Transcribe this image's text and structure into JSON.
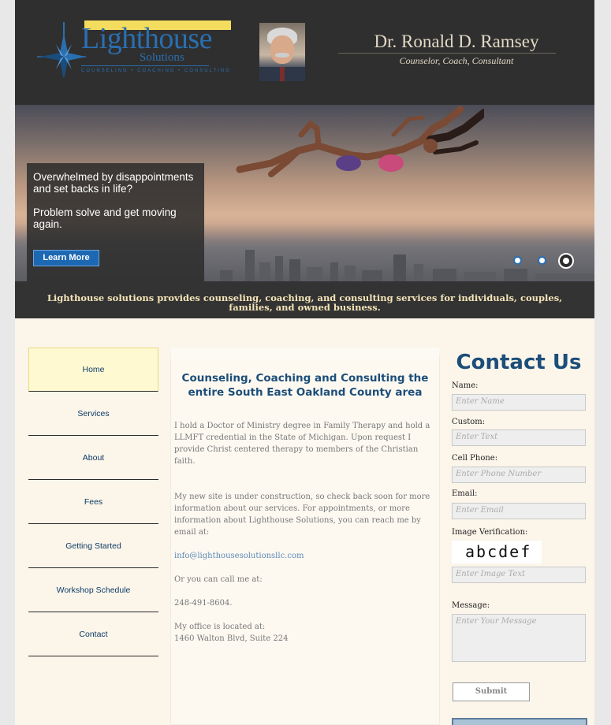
{
  "header": {
    "logo_text": "Lighthouse",
    "logo_sub": "Solutions",
    "logo_tagline": "COUNSELING • COACHING • CONSULTING",
    "name": "Dr. Ronald D. Ramsey",
    "title": "Counselor, Coach, Consultant"
  },
  "banner": {
    "line1": "Overwhelmed by disappointments and set backs in life?",
    "line2": "Problem solve and get moving again.",
    "button": "Learn More",
    "slides": 3,
    "active_slide": 3
  },
  "tagline": "Lighthouse solutions provides counseling, coaching, and consulting services for individuals, couples, families, and owned business.",
  "nav": {
    "items": [
      "Home",
      "Services",
      "About",
      "Fees",
      "Getting Started",
      "Workshop Schedule",
      "Contact"
    ],
    "active": "Home"
  },
  "content": {
    "heading": "Counseling, Coaching and Consulting the entire South East Oakland County area",
    "p1": "I hold a Doctor of Ministry degree in Family Therapy and hold a LLMFT credential in the State of Michigan.  Upon request I provide Christ centered therapy to members of the Christian faith.",
    "p2": "My new site is under construction, so check back soon for more information about our services.  For appointments, or more information about Lighthouse Solutions, you can reach me by email at:",
    "email": "info@lighthousesolutionsllc.com",
    "p4": "Or you can call me at:",
    "phone": "248-491-8604.",
    "office_label": "My office is located at:",
    "address": "1460 Walton Blvd, Suite 224"
  },
  "contact": {
    "title": "Contact Us",
    "name_label": "Name:",
    "name_placeholder": "Enter Name",
    "custom_label": "Custom:",
    "custom_placeholder": "Enter Text",
    "phone_label": "Cell Phone:",
    "phone_placeholder": "Enter Phone Number",
    "email_label": "Email:",
    "email_placeholder": "Enter Email",
    "captcha_label": "Image Verification:",
    "captcha_text": "abcdef",
    "captcha_placeholder": "Enter Image Text",
    "message_label": "Message:",
    "message_placeholder": "Enter Your Message",
    "submit": "Submit"
  },
  "colors": {
    "header_bg": "#2f2f2f",
    "brand_blue": "#1c4e7a",
    "button_blue": "#1d68b2",
    "page_bg": "#fbf5ea"
  }
}
